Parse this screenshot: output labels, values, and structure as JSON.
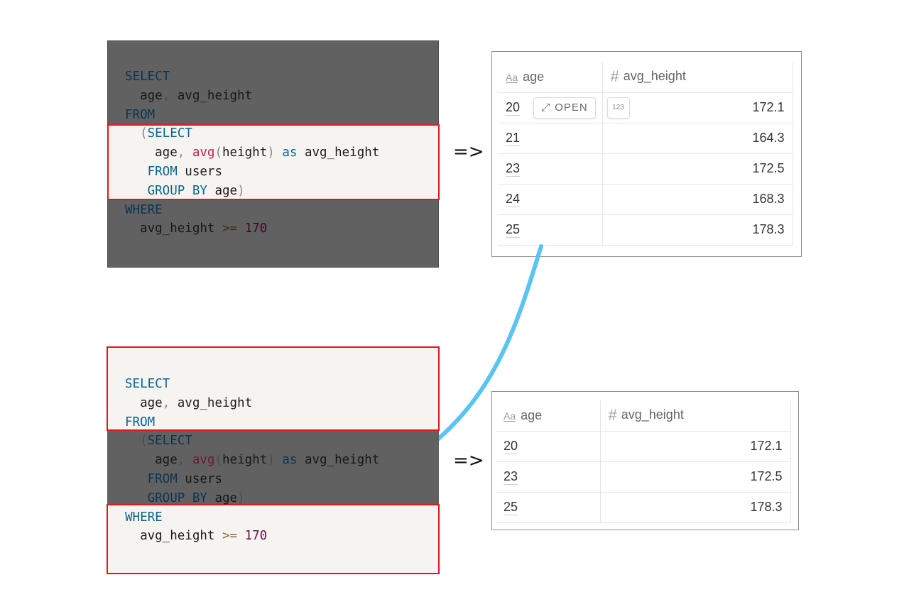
{
  "top_query": {
    "lines": [
      [
        {
          "t": "SELECT",
          "c": "kw"
        }
      ],
      [
        {
          "t": "  age",
          "c": "plain"
        },
        {
          "t": ",",
          "c": "punc"
        },
        {
          "t": " avg_height",
          "c": "plain"
        }
      ],
      [
        {
          "t": "FROM",
          "c": "kw"
        }
      ],
      [
        {
          "t": "  (",
          "c": "punc"
        },
        {
          "t": "SELECT",
          "c": "kw"
        }
      ],
      [
        {
          "t": "    age",
          "c": "plain"
        },
        {
          "t": ",",
          "c": "punc"
        },
        {
          "t": " ",
          "c": "plain"
        },
        {
          "t": "avg",
          "c": "fn"
        },
        {
          "t": "(",
          "c": "punc"
        },
        {
          "t": "height",
          "c": "plain"
        },
        {
          "t": ")",
          "c": "punc"
        },
        {
          "t": " ",
          "c": "plain"
        },
        {
          "t": "as",
          "c": "kw"
        },
        {
          "t": " avg_height",
          "c": "plain"
        }
      ],
      [
        {
          "t": "   ",
          "c": "plain"
        },
        {
          "t": "FROM",
          "c": "kw"
        },
        {
          "t": " users",
          "c": "plain"
        }
      ],
      [
        {
          "t": "   ",
          "c": "plain"
        },
        {
          "t": "GROUP BY",
          "c": "kw"
        },
        {
          "t": " age",
          "c": "plain"
        },
        {
          "t": ")",
          "c": "punc"
        }
      ],
      [
        {
          "t": "WHERE",
          "c": "kw"
        }
      ],
      [
        {
          "t": "  avg_height ",
          "c": "plain"
        },
        {
          "t": ">=",
          "c": "op"
        },
        {
          "t": " ",
          "c": "plain"
        },
        {
          "t": "170",
          "c": "num"
        }
      ]
    ]
  },
  "bottom_query": {
    "lines": [
      [
        {
          "t": "SELECT",
          "c": "kw"
        }
      ],
      [
        {
          "t": "  age",
          "c": "plain"
        },
        {
          "t": ",",
          "c": "punc"
        },
        {
          "t": " avg_height",
          "c": "plain"
        }
      ],
      [
        {
          "t": "FROM",
          "c": "kw"
        }
      ],
      [
        {
          "t": "  (",
          "c": "punc"
        },
        {
          "t": "SELECT",
          "c": "kw"
        }
      ],
      [
        {
          "t": "    age",
          "c": "plain"
        },
        {
          "t": ",",
          "c": "punc"
        },
        {
          "t": " ",
          "c": "plain"
        },
        {
          "t": "avg",
          "c": "fn"
        },
        {
          "t": "(",
          "c": "punc"
        },
        {
          "t": "height",
          "c": "plain"
        },
        {
          "t": ")",
          "c": "punc"
        },
        {
          "t": " ",
          "c": "plain"
        },
        {
          "t": "as",
          "c": "kw"
        },
        {
          "t": " avg_height",
          "c": "plain"
        }
      ],
      [
        {
          "t": "   ",
          "c": "plain"
        },
        {
          "t": "FROM",
          "c": "kw"
        },
        {
          "t": " users",
          "c": "plain"
        }
      ],
      [
        {
          "t": "   ",
          "c": "plain"
        },
        {
          "t": "GROUP BY",
          "c": "kw"
        },
        {
          "t": " age",
          "c": "plain"
        },
        {
          "t": ")",
          "c": "punc"
        }
      ],
      [
        {
          "t": "WHERE",
          "c": "kw"
        }
      ],
      [
        {
          "t": "  avg_height ",
          "c": "plain"
        },
        {
          "t": ">=",
          "c": "op"
        },
        {
          "t": " ",
          "c": "plain"
        },
        {
          "t": "170",
          "c": "num"
        }
      ]
    ]
  },
  "arrow_symbol": "=>",
  "table_top": {
    "headers": {
      "age": "age",
      "avg_height": "avg_height"
    },
    "rows": [
      {
        "age": "20",
        "avg_height": "172.1"
      },
      {
        "age": "21",
        "avg_height": "164.3"
      },
      {
        "age": "23",
        "avg_height": "172.5"
      },
      {
        "age": "24",
        "avg_height": "168.3"
      },
      {
        "age": "25",
        "avg_height": "178.3"
      }
    ],
    "open_label": "OPEN",
    "number_icon_label": "123"
  },
  "table_bottom": {
    "headers": {
      "age": "age",
      "avg_height": "avg_height"
    },
    "rows": [
      {
        "age": "20",
        "avg_height": "172.1"
      },
      {
        "age": "23",
        "avg_height": "172.5"
      },
      {
        "age": "25",
        "avg_height": "178.3"
      }
    ]
  },
  "colors": {
    "highlight_border": "#e0181b",
    "flow_arrow": "#5bc4f2",
    "dim_background": "#616161",
    "code_background": "#f6f4f0"
  }
}
